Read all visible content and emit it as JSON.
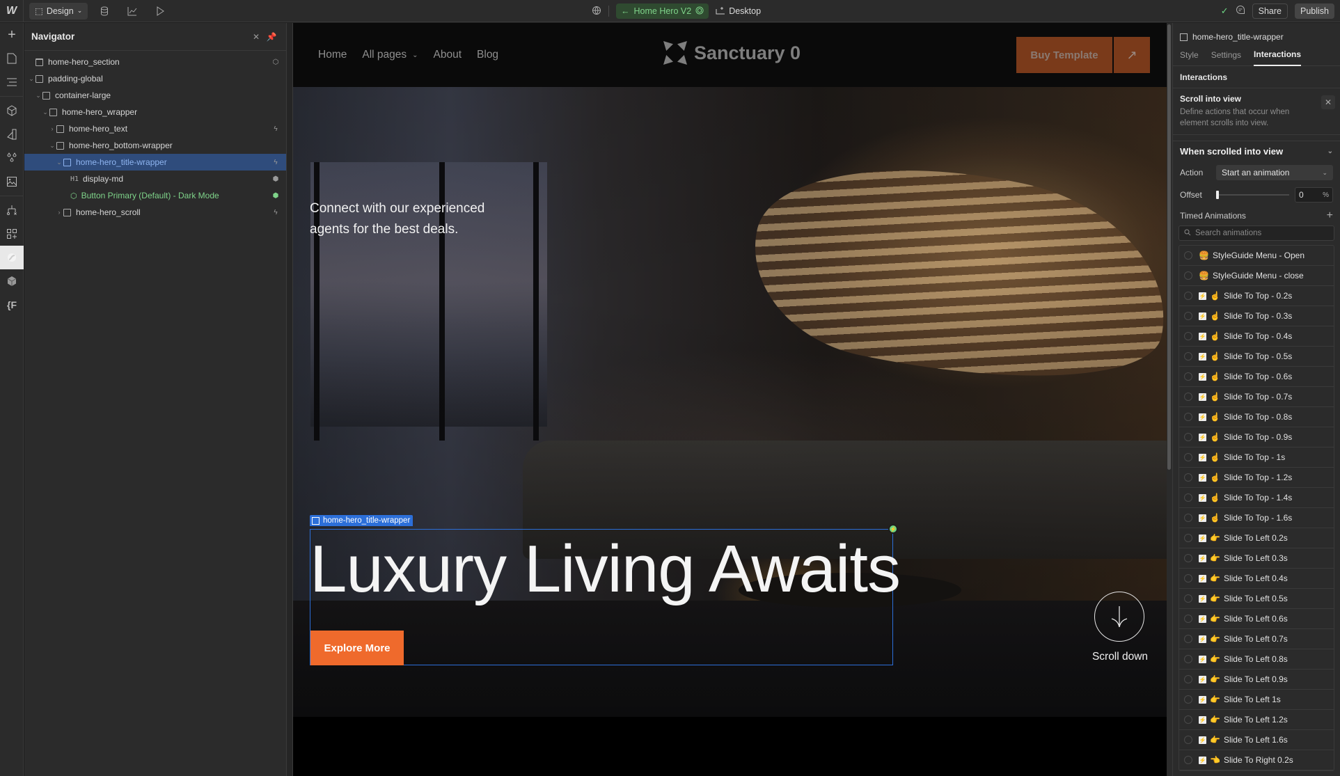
{
  "topbar": {
    "logo": "W",
    "mode_label": "Design",
    "page_name": "Home Hero V2",
    "breakpoint": "Desktop",
    "share_label": "Share",
    "publish_label": "Publish",
    "accent_green": "#7fd48a"
  },
  "rail": {
    "items": [
      "add-icon",
      "pages-icon",
      "navigator-icon",
      "components-icon",
      "styles-icon",
      "variables-icon",
      "assets-icon",
      "logic-icon",
      "apps-icon",
      "lottie-icon",
      "cms-icon",
      "code-icon"
    ]
  },
  "navigator": {
    "title": "Navigator",
    "tree": [
      {
        "label": "home-hero_section",
        "depth": 0,
        "caret": "",
        "icon": "section-icon",
        "right": "component-icon"
      },
      {
        "label": "padding-global",
        "depth": 0,
        "caret": "v",
        "icon": "div-icon",
        "right": ""
      },
      {
        "label": "container-large",
        "depth": 1,
        "caret": "v",
        "icon": "div-icon",
        "right": ""
      },
      {
        "label": "home-hero_wrapper",
        "depth": 2,
        "caret": "v",
        "icon": "div-icon",
        "right": ""
      },
      {
        "label": "home-hero_text",
        "depth": 3,
        "caret": ">",
        "icon": "div-icon",
        "right": "interaction-icon"
      },
      {
        "label": "home-hero_bottom-wrapper",
        "depth": 3,
        "caret": "v",
        "icon": "div-icon",
        "right": ""
      },
      {
        "label": "home-hero_title-wrapper",
        "depth": 4,
        "caret": "v",
        "icon": "div-icon",
        "right": "interaction-icon",
        "selected": true
      },
      {
        "label": "display-md",
        "depth": 5,
        "caret": "",
        "tag": "H1",
        "right": "style-icon"
      },
      {
        "label": "Button Primary (Default) - Dark Mode",
        "depth": 5,
        "caret": "",
        "icon": "component-icon",
        "right": "style-icon",
        "component": true
      },
      {
        "label": "home-hero_scroll",
        "depth": 4,
        "caret": ">",
        "icon": "div-icon",
        "right": "interaction-icon"
      }
    ]
  },
  "site": {
    "nav_links": [
      "Home",
      "All pages",
      "About",
      "Blog"
    ],
    "brand": "Sanctuary 0",
    "buy_label": "Buy Template",
    "arrow": "↗",
    "hero_text": "Connect with our experienced agents for the best deals.",
    "selection_tag": "home-hero_title-wrapper",
    "hero_title": "Luxury Living Awaits",
    "explore_label": "Explore More",
    "scroll_label": "Scroll down",
    "accent_orange": "#ef6a2c",
    "selection_blue": "#2c6fd9"
  },
  "panel": {
    "element_name": "home-hero_title-wrapper",
    "tabs": [
      "Style",
      "Settings",
      "Interactions"
    ],
    "active_tab": "Interactions",
    "section_title": "Interactions",
    "trigger_title": "Scroll into view",
    "trigger_desc": "Define actions that occur when element scrolls into view.",
    "when_title": "When scrolled into view",
    "action_label": "Action",
    "action_value": "Start an animation",
    "offset_label": "Offset",
    "offset_value": "0",
    "offset_unit": "%",
    "timed_label": "Timed Animations",
    "search_placeholder": "Search animations",
    "animations": [
      {
        "emoji": "🍔",
        "label": "StyleGuide Menu - Open",
        "badge": false
      },
      {
        "emoji": "🍔",
        "label": "StyleGuide Menu - close",
        "badge": false
      },
      {
        "emoji": "☝️",
        "label": "Slide To Top - 0.2s",
        "badge": true
      },
      {
        "emoji": "☝️",
        "label": "Slide To Top - 0.3s",
        "badge": true
      },
      {
        "emoji": "☝️",
        "label": "Slide To Top - 0.4s",
        "badge": true
      },
      {
        "emoji": "☝️",
        "label": "Slide To Top - 0.5s",
        "badge": true
      },
      {
        "emoji": "☝️",
        "label": "Slide To Top - 0.6s",
        "badge": true
      },
      {
        "emoji": "☝️",
        "label": "Slide To Top - 0.7s",
        "badge": true
      },
      {
        "emoji": "☝️",
        "label": "Slide To Top - 0.8s",
        "badge": true
      },
      {
        "emoji": "☝️",
        "label": "Slide To Top - 0.9s",
        "badge": true
      },
      {
        "emoji": "☝️",
        "label": "Slide To Top - 1s",
        "badge": true
      },
      {
        "emoji": "☝️",
        "label": "Slide To Top - 1.2s",
        "badge": true
      },
      {
        "emoji": "☝️",
        "label": "Slide To Top - 1.4s",
        "badge": true
      },
      {
        "emoji": "☝️",
        "label": "Slide To Top - 1.6s",
        "badge": true
      },
      {
        "emoji": "👉",
        "label": "Slide To Left 0.2s",
        "badge": true
      },
      {
        "emoji": "👉",
        "label": "Slide To Left 0.3s",
        "badge": true
      },
      {
        "emoji": "👉",
        "label": "Slide To Left 0.4s",
        "badge": true
      },
      {
        "emoji": "👉",
        "label": "Slide To Left 0.5s",
        "badge": true
      },
      {
        "emoji": "👉",
        "label": "Slide To Left 0.6s",
        "badge": true
      },
      {
        "emoji": "👉",
        "label": "Slide To Left 0.7s",
        "badge": true
      },
      {
        "emoji": "👉",
        "label": "Slide To Left 0.8s",
        "badge": true
      },
      {
        "emoji": "👉",
        "label": "Slide To Left 0.9s",
        "badge": true
      },
      {
        "emoji": "👉",
        "label": "Slide To Left 1s",
        "badge": true
      },
      {
        "emoji": "👉",
        "label": "Slide To Left 1.2s",
        "badge": true
      },
      {
        "emoji": "👉",
        "label": "Slide To Left 1.6s",
        "badge": true
      },
      {
        "emoji": "👈",
        "label": "Slide To Right 0.2s",
        "badge": true
      }
    ]
  }
}
